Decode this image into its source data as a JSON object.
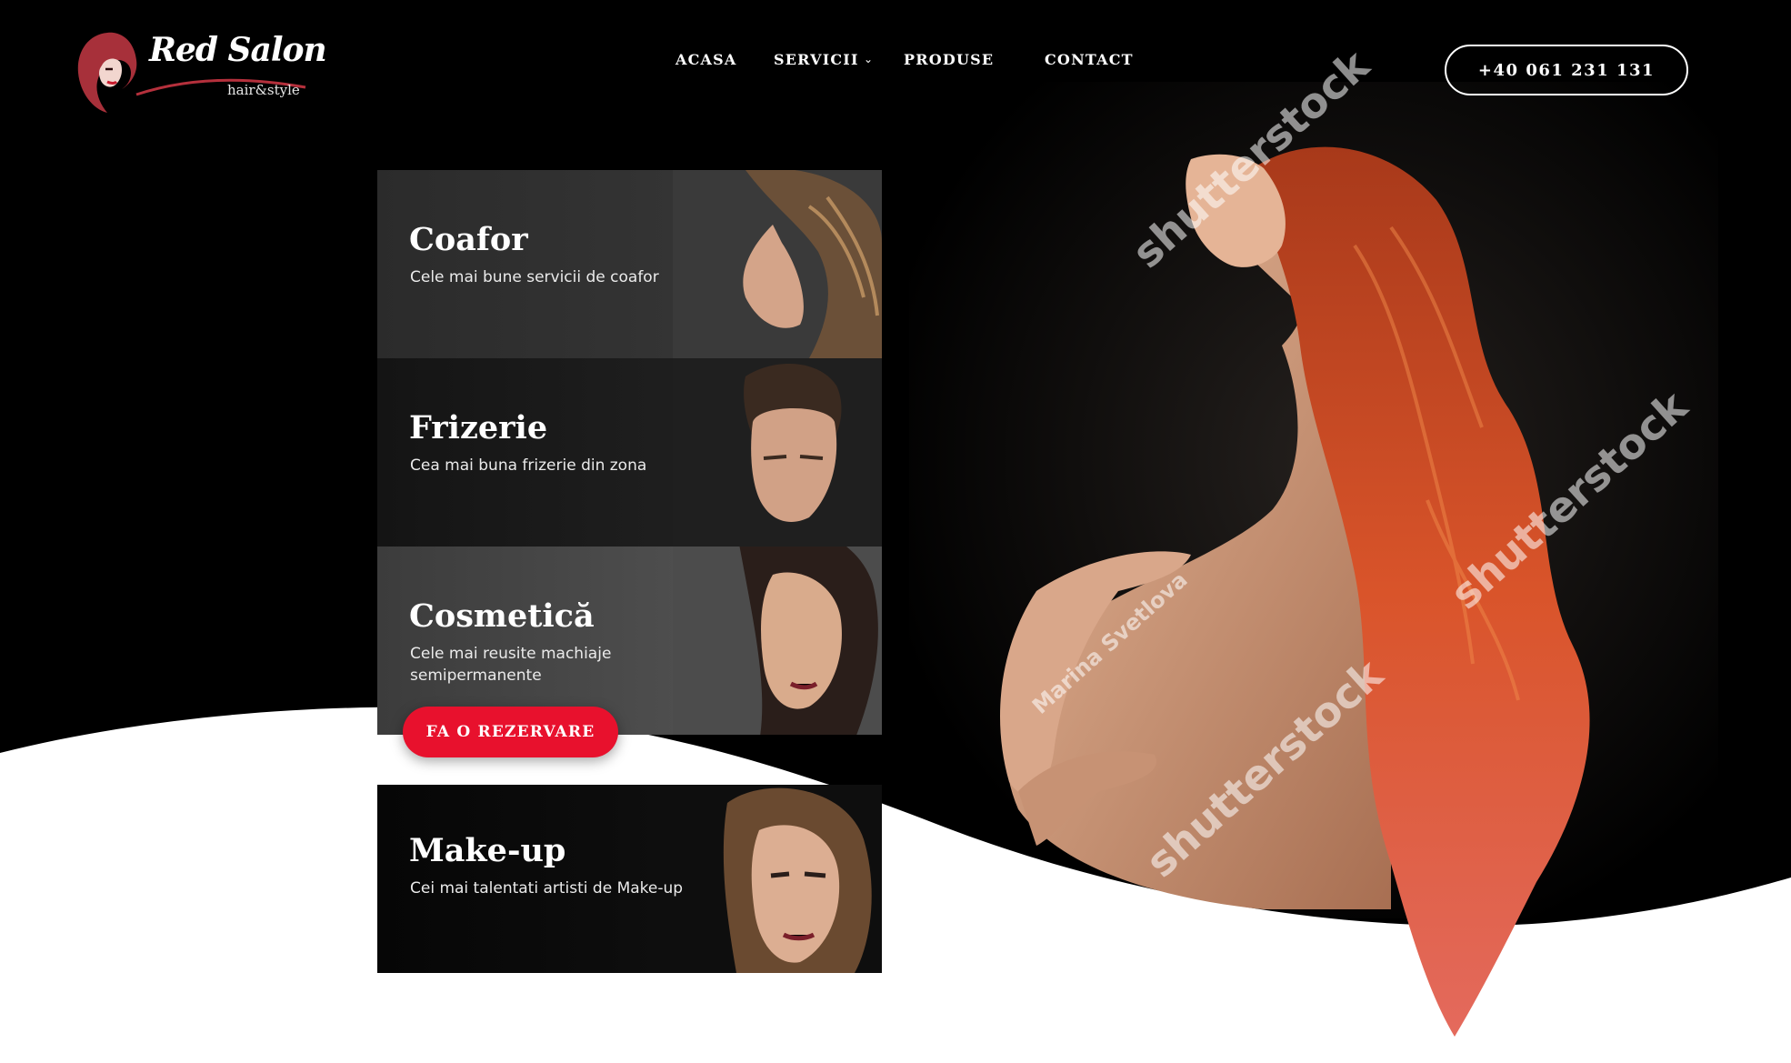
{
  "brand": {
    "name": "Red Salon",
    "tagline": "hair&style"
  },
  "nav": {
    "items": [
      "ACASA",
      "SERVICII",
      "PRODUSE",
      "CONTACT"
    ],
    "chevron_icon": "chevron-down-icon"
  },
  "phone": {
    "label": "+40 061 231 131"
  },
  "services": [
    {
      "title": "Coafor",
      "description": "Cele mai bune servicii de coafor"
    },
    {
      "title": "Frizerie",
      "description": "Cea mai buna frizerie din zona"
    },
    {
      "title": "Cosmetică",
      "description": "Cele mai reusite machiaje semipermanente"
    },
    {
      "title": "Make-up",
      "description": "Cei mai talentati artisti de Make-up"
    }
  ],
  "cta": {
    "label": "FA O REZERVARE"
  },
  "watermarks": {
    "stock": "shutterstock",
    "author": "Marina Svetlova"
  },
  "colors": {
    "background": "#000000",
    "accent": "#e8112d",
    "text": "#ffffff",
    "hair": "#c8451d"
  }
}
